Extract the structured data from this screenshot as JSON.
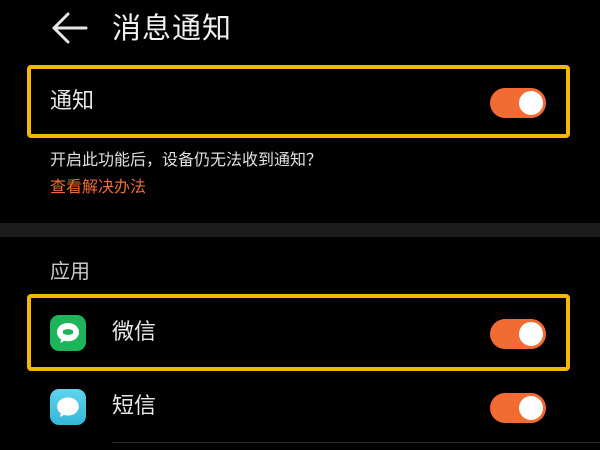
{
  "header": {
    "back_icon": "back-arrow-icon",
    "title": "消息通知"
  },
  "notification": {
    "label": "通知",
    "enabled": true,
    "hint": "开启此功能后，设备仍无法收到通知？",
    "link": "查看解决办法"
  },
  "apps_section": {
    "title": "应用",
    "items": [
      {
        "label": "微信",
        "icon": "wechat-icon",
        "enabled": true
      },
      {
        "label": "短信",
        "icon": "sms-icon",
        "enabled": true
      }
    ]
  },
  "colors": {
    "accent": "#f26b32",
    "highlight": "#f5b700",
    "background": "#000000",
    "wechat": "#1db55a",
    "sms": "#4cc6e6"
  }
}
